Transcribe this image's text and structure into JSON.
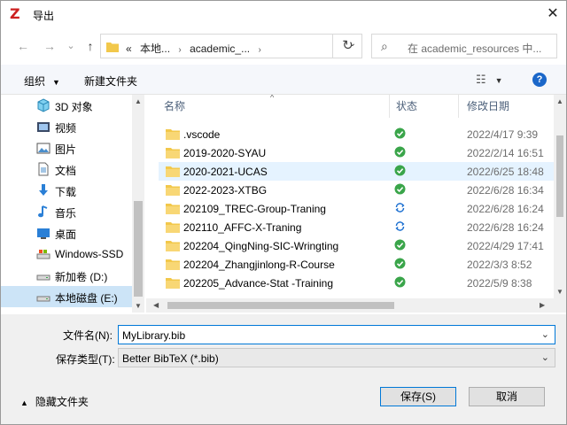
{
  "window": {
    "title": "导出",
    "close": "✕"
  },
  "nav": {
    "back": "←",
    "forward": "→",
    "recent": "⌄",
    "up": "↑",
    "address": {
      "prefix": "«",
      "crumbs": [
        "本地...",
        "academic_..."
      ],
      "sep": "›"
    },
    "refresh": "↻",
    "search_placeholder": "在 academic_resources 中..."
  },
  "toolbar": {
    "organize": "组织",
    "new_folder": "新建文件夹",
    "help": "?"
  },
  "sidebar": {
    "items": [
      {
        "label": "3D 对象",
        "icon": "3d-objects-icon"
      },
      {
        "label": "视频",
        "icon": "video-icon"
      },
      {
        "label": "图片",
        "icon": "pictures-icon"
      },
      {
        "label": "文档",
        "icon": "documents-icon"
      },
      {
        "label": "下载",
        "icon": "downloads-icon"
      },
      {
        "label": "音乐",
        "icon": "music-icon"
      },
      {
        "label": "桌面",
        "icon": "desktop-icon"
      },
      {
        "label": "Windows-SSD",
        "icon": "drive-icon"
      },
      {
        "label": "新加卷 (D:)",
        "icon": "drive-icon"
      },
      {
        "label": "本地磁盘 (E:)",
        "icon": "drive-icon",
        "selected": true
      }
    ]
  },
  "columns": {
    "name": "名称",
    "status": "状态",
    "date": "修改日期"
  },
  "files": [
    {
      "name": ".vscode",
      "status": "synced",
      "date": "2022/4/17 9:39"
    },
    {
      "name": "2019-2020-SYAU",
      "status": "synced",
      "date": "2022/2/14 16:51"
    },
    {
      "name": "2020-2021-UCAS",
      "status": "synced",
      "date": "2022/6/25 18:48",
      "selected": true
    },
    {
      "name": "2022-2023-XTBG",
      "status": "synced",
      "date": "2022/6/28 16:34"
    },
    {
      "name": "202109_TREC-Group-Traning",
      "status": "syncing",
      "date": "2022/6/28 16:24"
    },
    {
      "name": "202110_AFFC-X-Traning",
      "status": "syncing",
      "date": "2022/6/28 16:24"
    },
    {
      "name": "202204_QingNing-SIC-Wringting",
      "status": "synced",
      "date": "2022/4/29 17:41"
    },
    {
      "name": "202204_Zhangjinlong-R-Course",
      "status": "synced",
      "date": "2022/3/3 8:52"
    },
    {
      "name": "202205_Advance-Stat -Training",
      "status": "synced",
      "date": "2022/5/9 8:38"
    }
  ],
  "save": {
    "filename_label": "文件名(N):",
    "filename_value": "MyLibrary.bib",
    "type_label": "保存类型(T):",
    "type_value": "Better BibTeX (*.bib)",
    "hide_folders": "隐藏文件夹",
    "save_button": "保存(S)",
    "cancel_button": "取消"
  },
  "colors": {
    "accent": "#0078d7",
    "synced": "#3aa54a",
    "syncing": "#1b6fd1",
    "folder": "#f2c84b",
    "app": "#cc1f1f"
  }
}
